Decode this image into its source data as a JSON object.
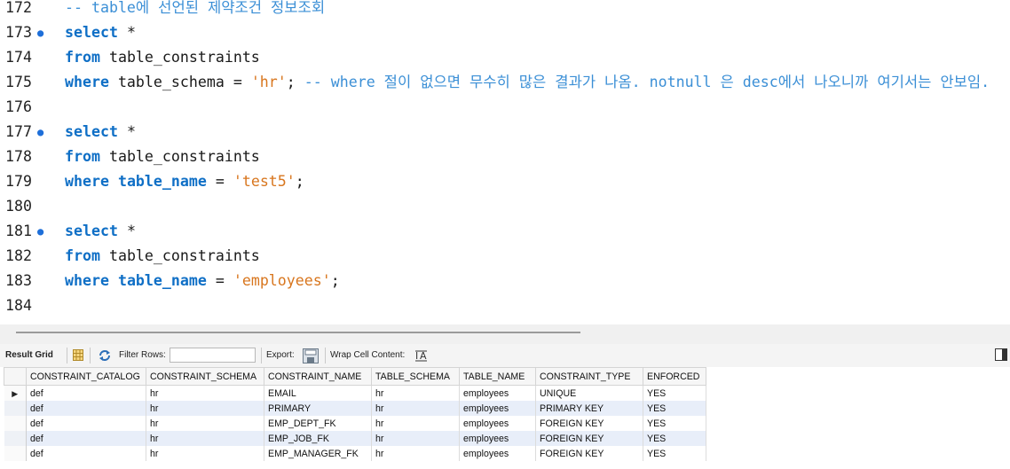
{
  "editor": {
    "lines": [
      {
        "no": "172",
        "marker": "",
        "tokens": [
          {
            "t": "-- table에 선언된 제약조건 정보조회",
            "c": "cmt"
          }
        ]
      },
      {
        "no": "173",
        "marker": "●",
        "tokens": [
          {
            "t": "select",
            "c": "kw"
          },
          {
            "t": " *",
            "c": "plain"
          }
        ]
      },
      {
        "no": "174",
        "marker": "",
        "tokens": [
          {
            "t": "from",
            "c": "kw"
          },
          {
            "t": " table_constraints",
            "c": "plain"
          }
        ]
      },
      {
        "no": "175",
        "marker": "",
        "tokens": [
          {
            "t": "where",
            "c": "kw"
          },
          {
            "t": " table_schema = ",
            "c": "plain"
          },
          {
            "t": "'hr'",
            "c": "str"
          },
          {
            "t": "; ",
            "c": "plain"
          },
          {
            "t": "-- where 절이 없으면 무수히 많은 결과가 나옴. notnull 은 desc에서 나오니까 여기서는 안보임.",
            "c": "cmt"
          }
        ]
      },
      {
        "no": "176",
        "marker": "",
        "tokens": []
      },
      {
        "no": "177",
        "marker": "●",
        "tokens": [
          {
            "t": "select",
            "c": "kw"
          },
          {
            "t": " *",
            "c": "plain"
          }
        ]
      },
      {
        "no": "178",
        "marker": "",
        "tokens": [
          {
            "t": "from",
            "c": "kw"
          },
          {
            "t": " table_constraints",
            "c": "plain"
          }
        ]
      },
      {
        "no": "179",
        "marker": "",
        "tokens": [
          {
            "t": "where",
            "c": "kw"
          },
          {
            "t": " ",
            "c": "plain"
          },
          {
            "t": "table_name",
            "c": "bold-ident"
          },
          {
            "t": " = ",
            "c": "plain"
          },
          {
            "t": "'test5'",
            "c": "str"
          },
          {
            "t": ";",
            "c": "plain"
          }
        ]
      },
      {
        "no": "180",
        "marker": "",
        "tokens": []
      },
      {
        "no": "181",
        "marker": "●",
        "tokens": [
          {
            "t": "select",
            "c": "kw"
          },
          {
            "t": " *",
            "c": "plain"
          }
        ]
      },
      {
        "no": "182",
        "marker": "",
        "tokens": [
          {
            "t": "from",
            "c": "kw"
          },
          {
            "t": " table_constraints",
            "c": "plain"
          }
        ]
      },
      {
        "no": "183",
        "marker": "",
        "tokens": [
          {
            "t": "where",
            "c": "kw"
          },
          {
            "t": " ",
            "c": "plain"
          },
          {
            "t": "table_name",
            "c": "bold-ident"
          },
          {
            "t": " = ",
            "c": "plain"
          },
          {
            "t": "'employees'",
            "c": "str"
          },
          {
            "t": ";",
            "c": "plain"
          }
        ]
      },
      {
        "no": "184",
        "marker": "",
        "tokens": []
      }
    ]
  },
  "toolbar": {
    "result_grid_label": "Result Grid",
    "filter_rows_label": "Filter Rows:",
    "filter_rows_value": "",
    "export_label": "Export:",
    "wrap_label": "Wrap Cell Content:",
    "wrap_icon_glyph": "Ī̲A"
  },
  "results": {
    "columns": [
      "CONSTRAINT_CATALOG",
      "CONSTRAINT_SCHEMA",
      "CONSTRAINT_NAME",
      "TABLE_SCHEMA",
      "TABLE_NAME",
      "CONSTRAINT_TYPE",
      "ENFORCED"
    ],
    "rows": [
      [
        "def",
        "hr",
        "EMAIL",
        "hr",
        "employees",
        "UNIQUE",
        "YES"
      ],
      [
        "def",
        "hr",
        "PRIMARY",
        "hr",
        "employees",
        "PRIMARY KEY",
        "YES"
      ],
      [
        "def",
        "hr",
        "EMP_DEPT_FK",
        "hr",
        "employees",
        "FOREIGN KEY",
        "YES"
      ],
      [
        "def",
        "hr",
        "EMP_JOB_FK",
        "hr",
        "employees",
        "FOREIGN KEY",
        "YES"
      ],
      [
        "def",
        "hr",
        "EMP_MANAGER_FK",
        "hr",
        "employees",
        "FOREIGN KEY",
        "YES"
      ]
    ],
    "selected_row": 0
  },
  "colors": {
    "keyword": "#0f6fc6",
    "string": "#d8761e",
    "comment": "#3b8fd6",
    "alt_row": "#e8eef9"
  }
}
